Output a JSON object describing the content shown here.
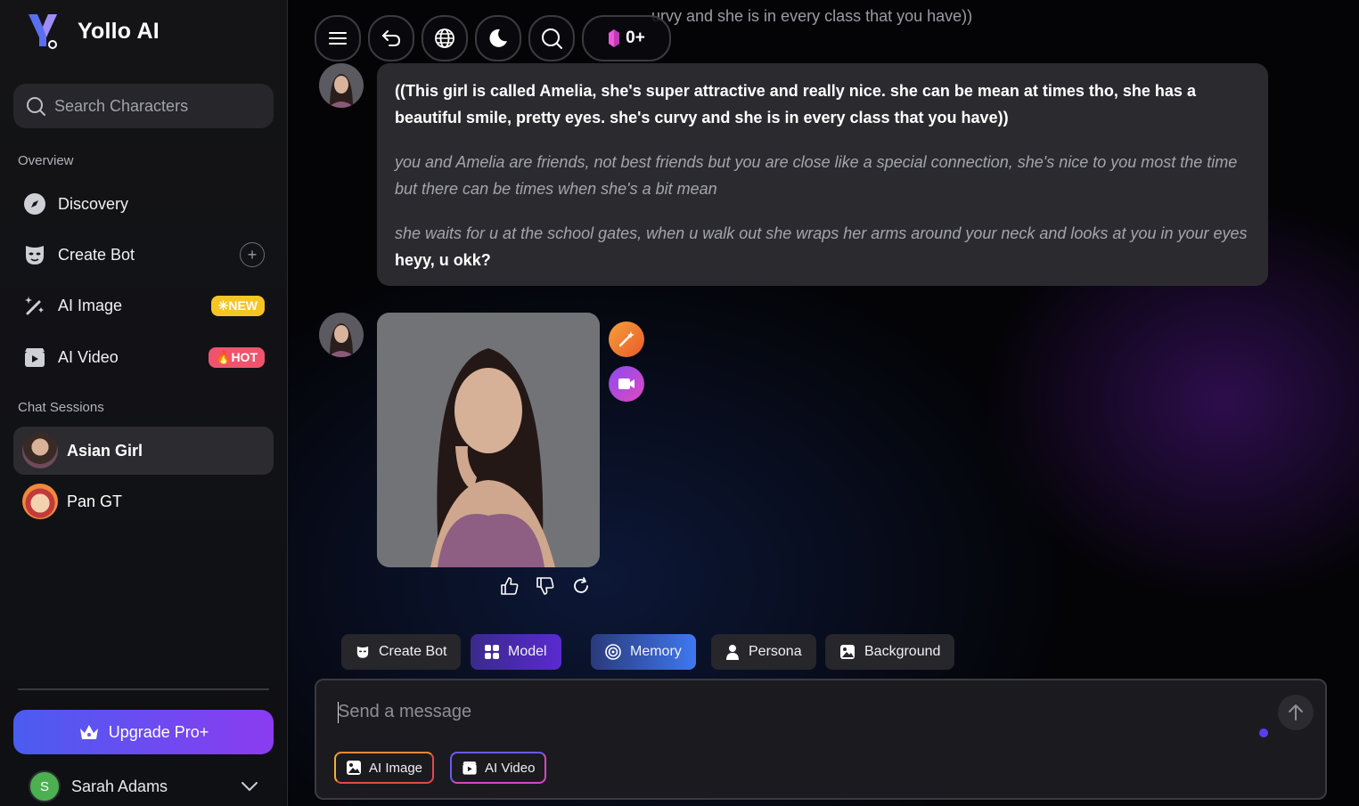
{
  "app": {
    "name": "Yollo AI"
  },
  "sidebar": {
    "search_placeholder": "Search Characters",
    "overview_label": "Overview",
    "nav": [
      {
        "label": "Discovery",
        "icon": "compass-icon"
      },
      {
        "label": "Create Bot",
        "icon": "mask-icon",
        "action": "+"
      },
      {
        "label": "AI Image",
        "icon": "magic-wand-icon",
        "badge": "NEW"
      },
      {
        "label": "AI Video",
        "icon": "video-camera-icon",
        "badge": "HOT"
      }
    ],
    "chat_sessions_label": "Chat Sessions",
    "sessions": [
      {
        "name": "Asian Girl",
        "active": true
      },
      {
        "name": "Pan GT",
        "active": false
      }
    ],
    "upgrade_label": "Upgrade Pro+",
    "user": {
      "initial": "S",
      "name": "Sarah Adams"
    }
  },
  "toolbar": {
    "gem_count": "0+"
  },
  "chat": {
    "truncated_top": "urvy and she is in every class that you have))",
    "intro_bold": "((This girl is called Amelia, she's super attractive and really nice. she can be mean at times tho, she has a beautiful smile, pretty eyes. she's curvy and she is in every class that you have))",
    "intro_italic_1": "you and Amelia are friends, not best friends but you are close like a special connection, she's nice to you most the time but there can be times when she's a bit mean",
    "intro_italic_2": "she waits for u at the school gates, when u walk out she wraps her arms around your neck and looks at you in your eyes",
    "intro_speech": "heyy, u okk?"
  },
  "chips": [
    {
      "label": "Create Bot",
      "icon": "mask-icon"
    },
    {
      "label": "Model",
      "icon": "grid-icon"
    },
    {
      "label": "Memory",
      "icon": "memory-icon"
    },
    {
      "label": "Persona",
      "icon": "person-icon"
    },
    {
      "label": "Background",
      "icon": "image-icon"
    }
  ],
  "composer": {
    "placeholder": "Send a message",
    "ai_image_label": "AI Image",
    "ai_video_label": "AI Video"
  },
  "colors": {
    "accent_purple": "#8b3cf0",
    "accent_blue": "#4a5cf0",
    "badge_new": "#f5c524",
    "badge_hot": "#f0546c",
    "bubble_bg": "#2b2b2f"
  }
}
